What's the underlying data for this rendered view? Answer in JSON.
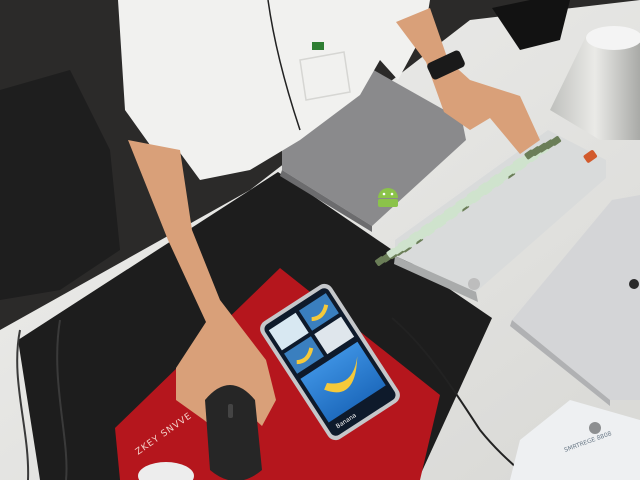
{
  "scene": {
    "mousepad_print": "ZKEY SNVVE",
    "phone_screen_label": "Banana",
    "box_print": "SMRTREGE 8808"
  },
  "colors": {
    "desk": "#e9e9e6",
    "floor": "#2b2a29",
    "desk_mat": "#1d1d1d",
    "mousepad": "#b5161d",
    "laptop_grey": "#8a8a8c",
    "macbook_silver": "#d4d5d7",
    "keyboard_case": "#d9dbdb",
    "keycap_mint": "#cfe3cd",
    "keycap_olive": "#6b7e58",
    "escape_key": "#d25a2c",
    "shirt": "#f1f1ef",
    "skin": "#d9a079",
    "banana": "#f5c93a",
    "phone_sky": "#2f86d8"
  },
  "icons": [
    "android-logo",
    "apple-logo",
    "banana-image"
  ]
}
